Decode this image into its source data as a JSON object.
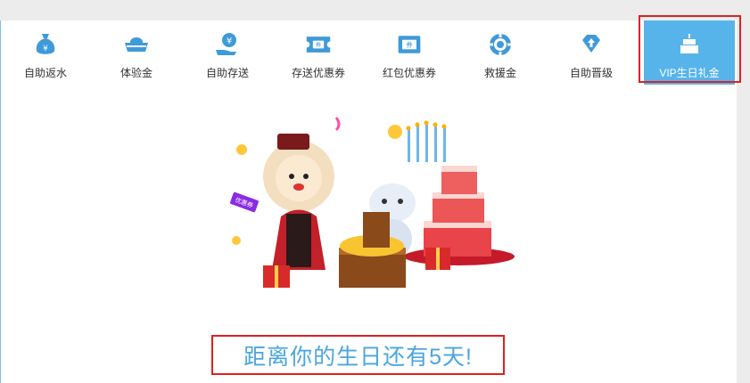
{
  "tabs": [
    {
      "label": "自助返水",
      "icon": "money-bag-icon"
    },
    {
      "label": "体验金",
      "icon": "gold-ingot-icon"
    },
    {
      "label": "自助存送",
      "icon": "hand-coin-icon"
    },
    {
      "label": "存送优惠券",
      "icon": "coupon-icon"
    },
    {
      "label": "红包优惠券",
      "icon": "coupon-ticket-icon"
    },
    {
      "label": "救援金",
      "icon": "chip-icon"
    },
    {
      "label": "自助晋级",
      "icon": "diamond-upgrade-icon"
    },
    {
      "label": "VIP生日礼金",
      "icon": "birthday-cake-icon",
      "active": true
    }
  ],
  "illustration": {
    "badge_text": "优惠券"
  },
  "countdown": {
    "text": "距离你的生日还有5天!"
  },
  "colors": {
    "accent": "#56b4ea",
    "icon_blue": "#3f9ad8",
    "highlight_red": "#e02020",
    "countdown_text": "#4aa6e0"
  }
}
